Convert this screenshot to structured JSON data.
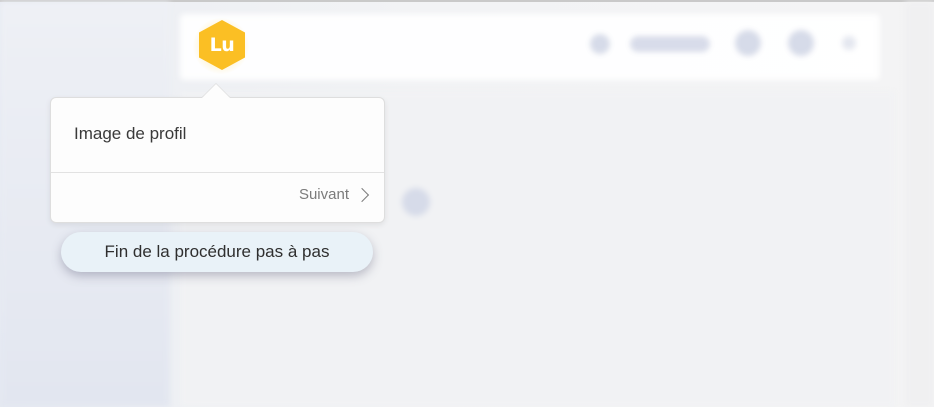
{
  "avatar": {
    "initials": "Lu",
    "color": "#fbbf24"
  },
  "popover": {
    "title": "Image de profil",
    "next_label": "Suivant",
    "next_icon": "chevron-right-icon"
  },
  "end_tour": {
    "label": "Fin de la procédure pas à pas"
  }
}
